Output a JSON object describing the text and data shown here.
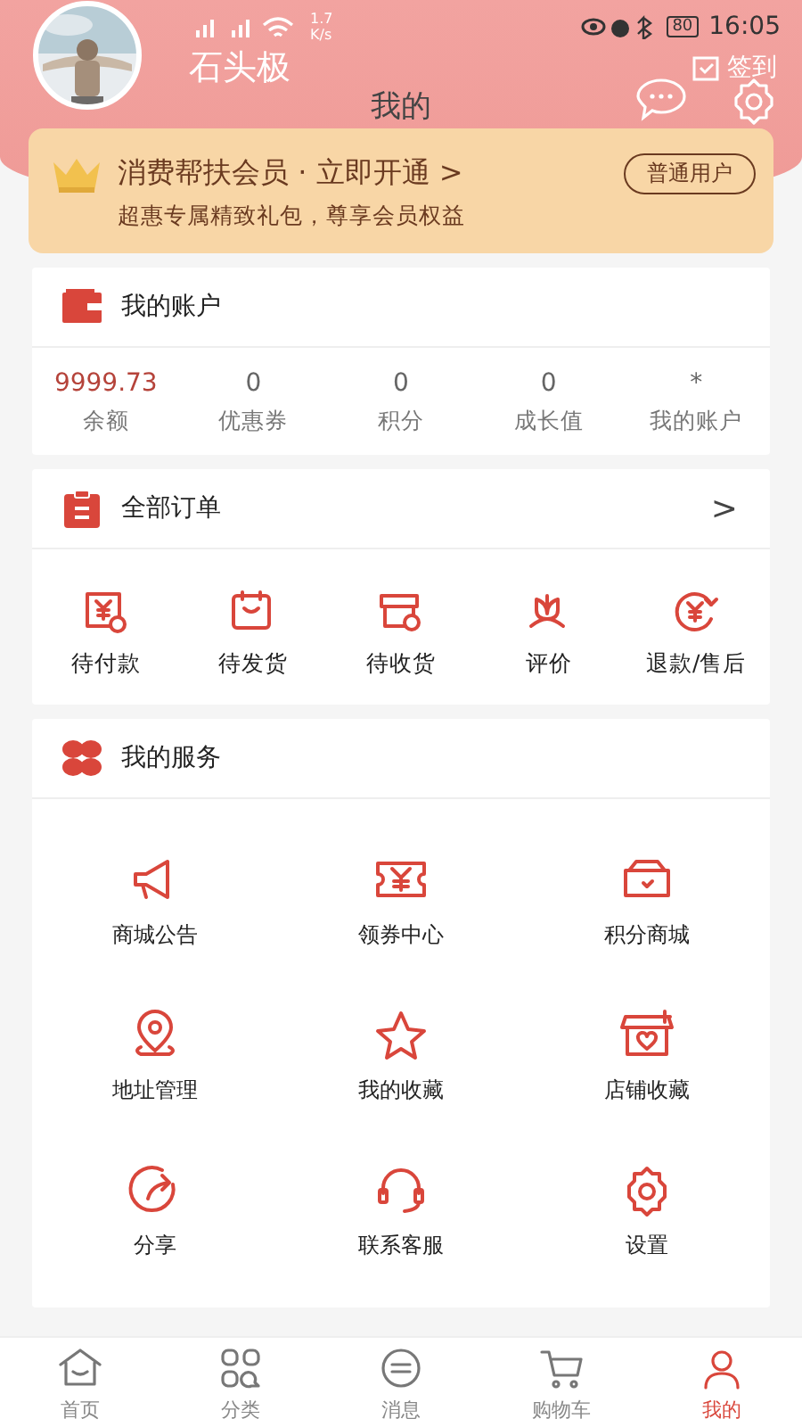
{
  "status_bar": {
    "speed": "1.7\nK/s",
    "battery": "80",
    "time": "16:05"
  },
  "user": {
    "name": "石头极",
    "checkin": "签到"
  },
  "title": "我的",
  "vip": {
    "title": "消费帮扶会员 · 立即开通 >",
    "subtitle": "超惠专属精致礼包，尊享会员权益",
    "badge": "普通用户"
  },
  "account": {
    "title": "我的账户",
    "stats": [
      {
        "value": "9999.73",
        "label": "余额",
        "highlight": true
      },
      {
        "value": "0",
        "label": "优惠券",
        "highlight": false
      },
      {
        "value": "0",
        "label": "积分",
        "highlight": false
      },
      {
        "value": "0",
        "label": "成长值",
        "highlight": false
      },
      {
        "value": "*",
        "label": "我的账户",
        "highlight": false
      }
    ]
  },
  "orders": {
    "title": "全部订单",
    "arrow": ">",
    "items": [
      {
        "label": "待付款"
      },
      {
        "label": "待发货"
      },
      {
        "label": "待收货"
      },
      {
        "label": "评价"
      },
      {
        "label": "退款/售后"
      }
    ]
  },
  "services": {
    "title": "我的服务",
    "items": [
      {
        "label": "商城公告"
      },
      {
        "label": "领券中心"
      },
      {
        "label": "积分商城"
      },
      {
        "label": "地址管理"
      },
      {
        "label": "我的收藏"
      },
      {
        "label": "店铺收藏"
      },
      {
        "label": "分享"
      },
      {
        "label": "联系客服"
      },
      {
        "label": "设置"
      }
    ]
  },
  "tabs": [
    {
      "label": "首页",
      "selected": false
    },
    {
      "label": "分类",
      "selected": false
    },
    {
      "label": "消息",
      "selected": false
    },
    {
      "label": "购物车",
      "selected": false
    },
    {
      "label": "我的",
      "selected": true
    }
  ]
}
